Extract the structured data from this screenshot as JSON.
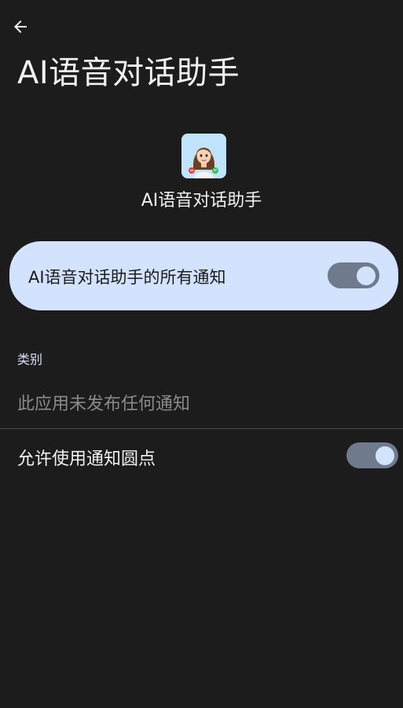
{
  "header": {
    "back_icon": "arrow-back-icon",
    "title": "AI语音对话助手"
  },
  "app": {
    "icon": "app-avatar-icon",
    "name": "AI语音对话助手"
  },
  "master_toggle": {
    "label": "AI语音对话助手的所有通知",
    "checked": true
  },
  "categories": {
    "header": "类别",
    "empty_message": "此应用未发布任何通知"
  },
  "notification_dot": {
    "label": "允许使用通知圆点",
    "checked": true
  },
  "colors": {
    "background": "#1c1c1c",
    "card": "#d3e3fd",
    "switch_track": "#6f7a8c",
    "switch_thumb": "#d3e3fd"
  }
}
